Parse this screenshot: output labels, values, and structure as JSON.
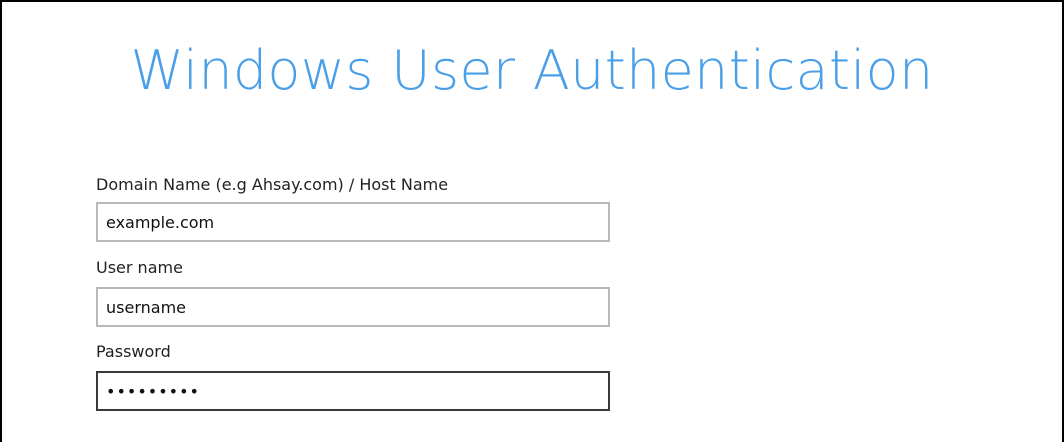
{
  "dialog": {
    "title": "Windows User Authentication"
  },
  "form": {
    "domain": {
      "label": "Domain Name (e.g Ahsay.com) / Host Name",
      "value": "example.com"
    },
    "username": {
      "label": "User name",
      "value": "username"
    },
    "password": {
      "label": "Password",
      "value": "secretpwd"
    }
  },
  "colors": {
    "title": "#4a9fe8",
    "input_border": "#b9b9b9",
    "focused_border": "#3a3a3a"
  }
}
